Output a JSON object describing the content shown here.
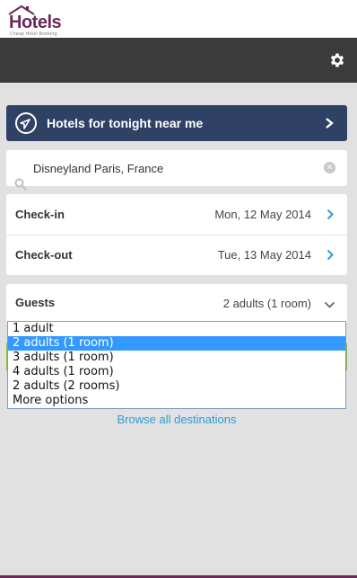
{
  "brand": {
    "name": "Hotels",
    "tagline": "Cheap Hotel Booking",
    "color": "#6b2a59"
  },
  "header": {
    "settings_icon": "gear-icon"
  },
  "tonight_button": {
    "label": "Hotels for tonight near me",
    "icon": "location-arrow-icon",
    "color": "#2f4266"
  },
  "search": {
    "value": "Disneyland Paris, France",
    "icon": "search-icon",
    "clear_icon": "clear-icon"
  },
  "checkin": {
    "label": "Check-in",
    "value": "Mon, 12 May 2014"
  },
  "checkout": {
    "label": "Check-out",
    "value": "Tue, 13 May 2014"
  },
  "guests": {
    "label": "Guests",
    "value": "2 adults (1 room)",
    "options": [
      "1 adult",
      "2 adults (1 room)",
      "3 adults (1 room)",
      "4 adults (1 room)",
      "2 adults (2 rooms)",
      "More options"
    ],
    "selected_index": 1
  },
  "browse_link": "Browse all destinations",
  "accent_link_color": "#2a9fd6",
  "selection_color": "#3399ff"
}
